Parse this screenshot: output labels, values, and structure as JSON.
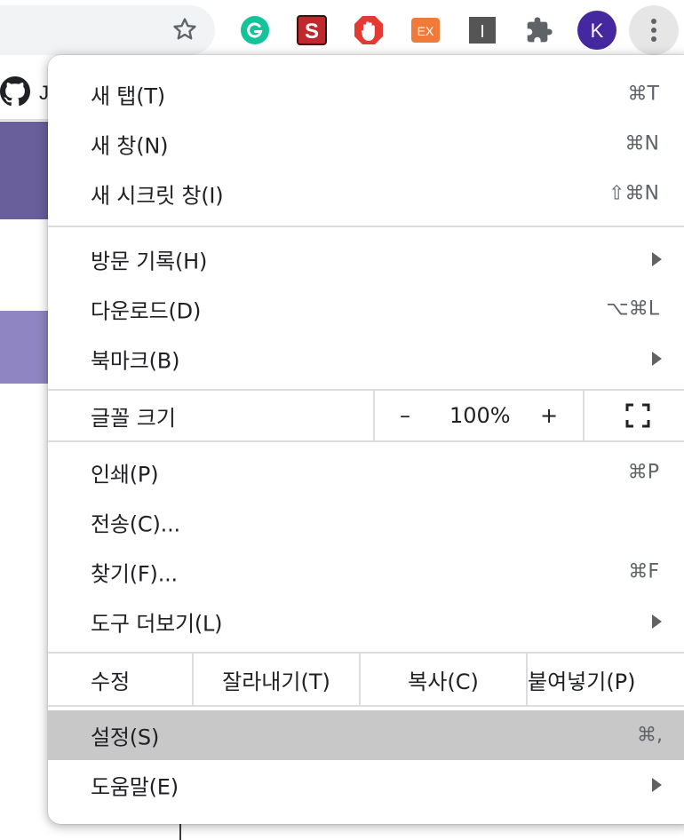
{
  "toolbar": {
    "avatar_letter": "K",
    "extensions": [
      {
        "name": "grammarly-extension-icon",
        "color": "#15c39a"
      },
      {
        "name": "s-extension-icon",
        "color": "#c0282d"
      },
      {
        "name": "adblock-extension-icon",
        "color": "#e53935"
      },
      {
        "name": "ex-extension-icon",
        "color": "#ef7a3a"
      },
      {
        "name": "i-extension-icon",
        "color": "#555555"
      },
      {
        "name": "puzzle-extensions-icon",
        "color": "#5f6368"
      }
    ],
    "ex_label": "EX",
    "s_label": "S",
    "i_label": "I",
    "avatar_color": "#4527a0"
  },
  "page": {
    "partial_letter": "J"
  },
  "menu": {
    "items": [
      {
        "label": "새 탭(T)",
        "shortcut": "⌘T"
      },
      {
        "label": "새 창(N)",
        "shortcut": "⌘N"
      },
      {
        "label": "새 시크릿 창(I)",
        "shortcut": "⇧⌘N"
      },
      {
        "label": "방문 기록(H)",
        "shortcut": ""
      },
      {
        "label": "다운로드(D)",
        "shortcut": "⌥⌘L"
      },
      {
        "label": "북마크(B)",
        "shortcut": ""
      },
      {
        "label": "인쇄(P)",
        "shortcut": "⌘P"
      },
      {
        "label": "전송(C)...",
        "shortcut": ""
      },
      {
        "label": "찾기(F)...",
        "shortcut": "⌘F"
      },
      {
        "label": "도구 더보기(L)",
        "shortcut": ""
      },
      {
        "label": "설정(S)",
        "shortcut": "⌘,"
      },
      {
        "label": "도움말(E)",
        "shortcut": ""
      }
    ],
    "zoom": {
      "label": "글꼴 크기",
      "minus": "–",
      "value": "100%",
      "plus": "+"
    },
    "edit": {
      "label": "수정",
      "cut": "잘라내기(T)",
      "copy": "복사(C)",
      "paste": "붙여넣기(P)"
    },
    "highlight_color": "#c8c8c8"
  }
}
